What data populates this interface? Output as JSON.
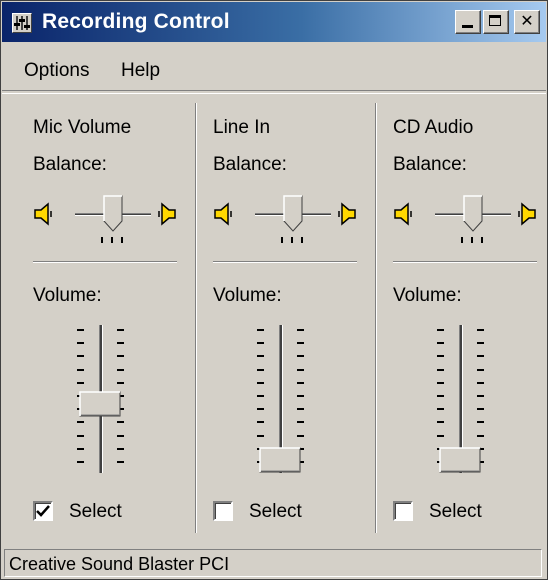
{
  "window": {
    "title": "Recording Control",
    "buttons": {
      "minimize": "",
      "maximize": "",
      "close": "✕"
    }
  },
  "menu": {
    "options": "Options",
    "help": "Help"
  },
  "channels": [
    {
      "name": "Mic Volume",
      "balance_label": "Balance:",
      "volume_label": "Volume:",
      "balance": 0.5,
      "volume": 0.4,
      "select_label": "Select",
      "selected": true
    },
    {
      "name": "Line In",
      "balance_label": "Balance:",
      "volume_label": "Volume:",
      "balance": 0.5,
      "volume": 0.0,
      "select_label": "Select",
      "selected": false
    },
    {
      "name": "CD Audio",
      "balance_label": "Balance:",
      "volume_label": "Volume:",
      "balance": 0.5,
      "volume": 0.0,
      "select_label": "Select",
      "selected": false
    }
  ],
  "status": {
    "text": "Creative Sound Blaster PCI"
  },
  "icons": {
    "app": "recording-control-icon",
    "left_speaker": "speaker-left-icon",
    "right_speaker": "speaker-right-icon",
    "check": "checkmark-icon"
  },
  "colors": {
    "title_start": "#0a246a",
    "title_end": "#a6caf0",
    "face": "#d4d0c8",
    "speaker": "#ffd800"
  }
}
